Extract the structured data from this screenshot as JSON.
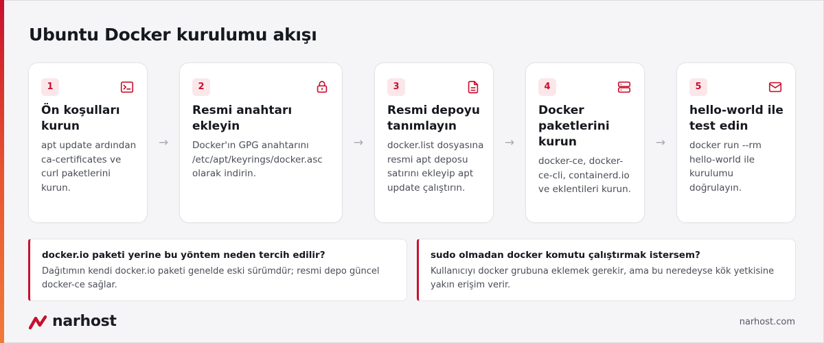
{
  "title": "Ubuntu Docker kurulumu akışı",
  "steps": [
    {
      "number": "1",
      "icon": "terminal-icon",
      "title": "Ön koşulları kurun",
      "description": "apt update ardından ca-certificates ve curl paketlerini kurun."
    },
    {
      "number": "2",
      "icon": "lock-icon",
      "title": "Resmi anahtarı ekleyin",
      "description": "Docker'ın GPG anahtarını /etc/apt/keyrings/docker.asc olarak indirin."
    },
    {
      "number": "3",
      "icon": "document-icon",
      "title": "Resmi depoyu tanımlayın",
      "description": "docker.list dosyasına resmi apt deposu satırını ekleyip apt update çalıştırın."
    },
    {
      "number": "4",
      "icon": "server-icon",
      "title": "Docker paketlerini kurun",
      "description": "docker-ce, docker-ce-cli, containerd.io ve eklentileri kurun."
    },
    {
      "number": "5",
      "icon": "mail-icon",
      "title": "hello-world ile test edin",
      "description": "docker run --rm hello-world ile kurulumu doğrulayın."
    }
  ],
  "faq": [
    {
      "question": "docker.io paketi yerine bu yöntem neden tercih edilir?",
      "answer": "Dağıtımın kendi docker.io paketi genelde eski sürümdür; resmi depo güncel docker-ce sağlar."
    },
    {
      "question": "sudo olmadan docker komutu çalıştırmak istersem?",
      "answer": "Kullanıcıyı docker grubuna eklemek gerekir, ama bu neredeyse kök yetkisine yakın erişim verir."
    }
  ],
  "brand": {
    "name": "narhost",
    "site": "narhost.com",
    "accent_color": "#c8102e"
  }
}
